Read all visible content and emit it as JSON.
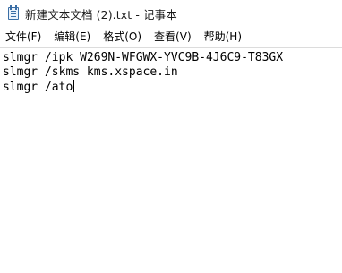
{
  "window": {
    "title": "新建文本文档 (2).txt - 记事本",
    "icon": "notepad-icon"
  },
  "menu": {
    "items": [
      "文件(F)",
      "编辑(E)",
      "格式(O)",
      "查看(V)",
      "帮助(H)"
    ]
  },
  "editor": {
    "lines": [
      "slmgr /ipk W269N-WFGWX-YVC9B-4J6C9-T83GX",
      "slmgr /skms kms.xspace.in",
      "slmgr /ato"
    ]
  }
}
